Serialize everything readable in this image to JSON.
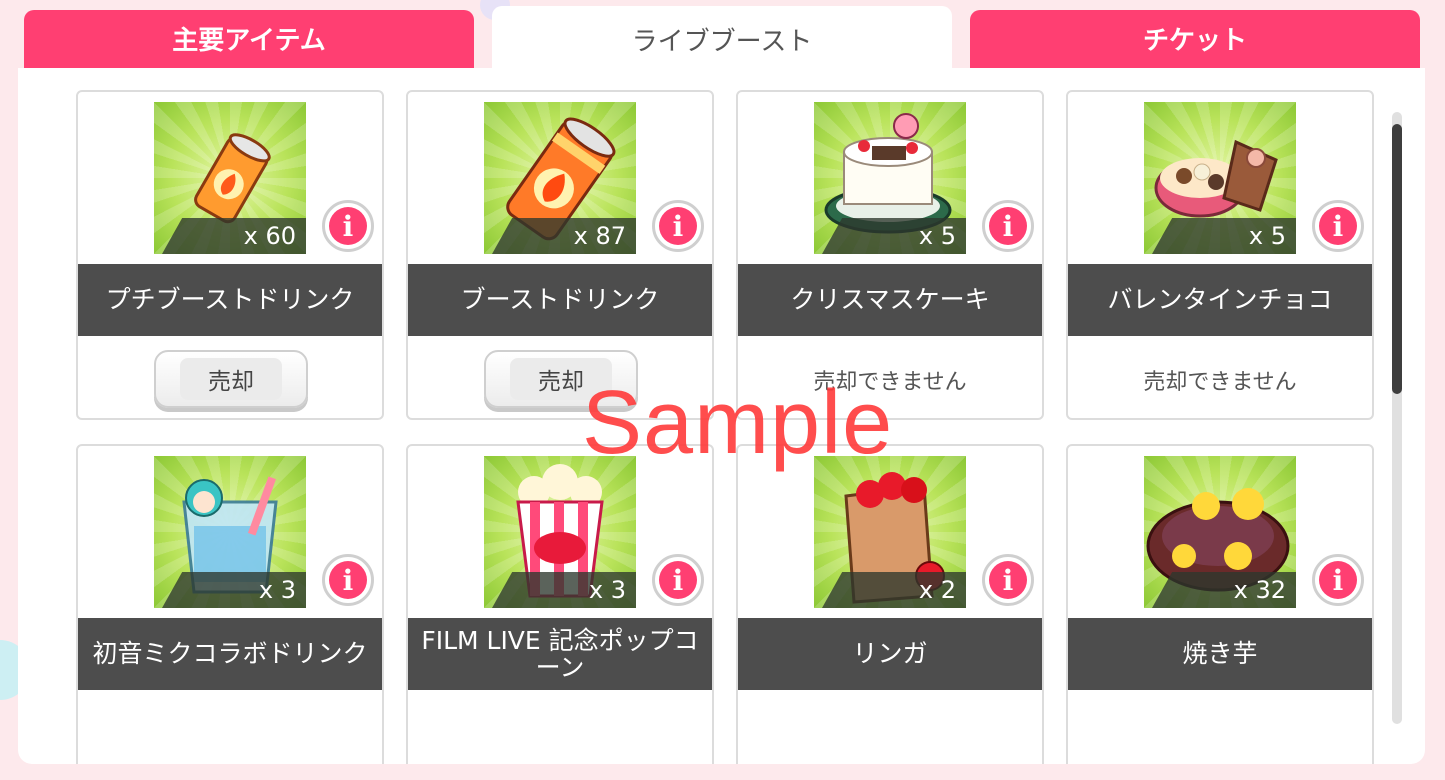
{
  "tabs": [
    {
      "label": "主要アイテム",
      "active": false
    },
    {
      "label": "ライブブースト",
      "active": true
    },
    {
      "label": "チケット",
      "active": false
    }
  ],
  "items": [
    {
      "name": "プチブーストドリンク",
      "count": "x 60",
      "sell_label": "売却",
      "sellable": true,
      "icon": "small-can-icon"
    },
    {
      "name": "ブーストドリンク",
      "count": "x 87",
      "sell_label": "売却",
      "sellable": true,
      "icon": "can-icon"
    },
    {
      "name": "クリスマスケーキ",
      "count": "x 5",
      "sell_label": "売却できません",
      "sellable": false,
      "icon": "cake-icon"
    },
    {
      "name": "バレンタインチョコ",
      "count": "x 5",
      "sell_label": "売却できません",
      "sellable": false,
      "icon": "chocolate-box-icon"
    },
    {
      "name": "初音ミクコラボドリンク",
      "count": "x 3",
      "icon": "drink-cup-icon"
    },
    {
      "name": "FILM LIVE 記念ポップコーン",
      "count": "x 3",
      "icon": "popcorn-icon"
    },
    {
      "name": "リンガ",
      "count": "x 2",
      "icon": "apple-bag-icon"
    },
    {
      "name": "焼き芋",
      "count": "x 32",
      "icon": "sweet-potato-icon"
    }
  ],
  "info_button_glyph": "i",
  "watermark": "Sample",
  "colors": {
    "accent": "#ff3f72",
    "name_bar": "#4d4d4d",
    "thumb_green": "#9fd44a"
  }
}
